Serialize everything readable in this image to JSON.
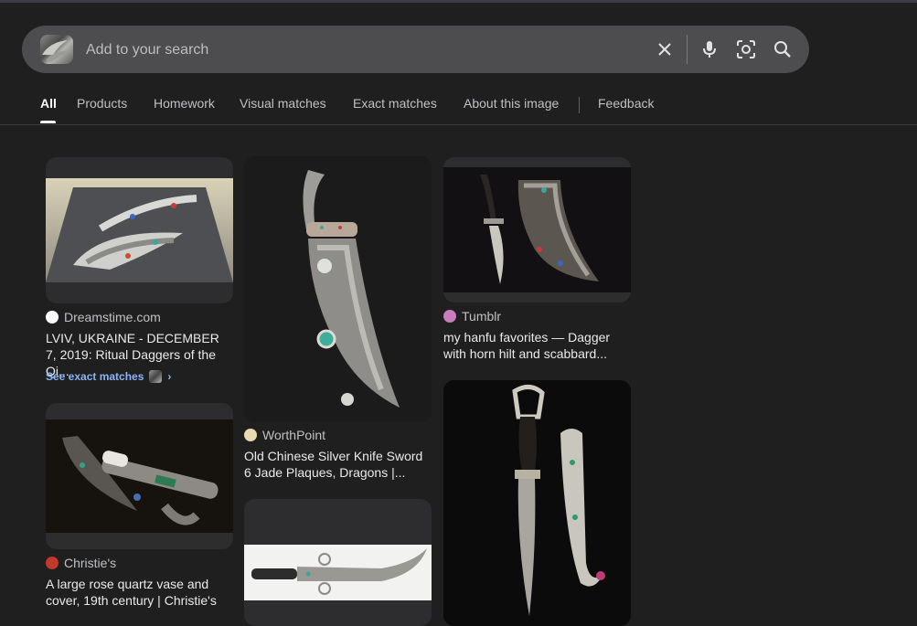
{
  "search": {
    "placeholder": "Add to your search",
    "icons": [
      "clear-icon",
      "mic-icon",
      "lens-icon",
      "search-icon"
    ]
  },
  "tabs": [
    {
      "label": "All",
      "active": true
    },
    {
      "label": "Products"
    },
    {
      "label": "Homework"
    },
    {
      "label": "Visual matches"
    },
    {
      "label": "Exact matches"
    },
    {
      "label": "About this image"
    },
    {
      "label": "Feedback"
    }
  ],
  "results": [
    {
      "source": "Dreamstime.com",
      "title": "LVIV, UKRAINE - DECEMBER 7, 2019: Ritual Daggers of the Qi...",
      "exact": "See exact matches",
      "favicon_color": "#ffffff"
    },
    {
      "source": "Christie's",
      "title": "A large rose quartz vase and cover, 19th century | Christie's",
      "favicon_color": "#c0392b"
    },
    {
      "source": "WorthPoint",
      "title": "Old Chinese Silver Knife Sword 6 Jade Plaques, Dragons |...",
      "favicon_color": "#e8d9b0"
    },
    {
      "source": "Tumblr",
      "title": "my hanfu favorites — Dagger with horn hilt and scabbard...",
      "favicon_color": "#c77dbb"
    }
  ],
  "colors": {
    "background": "#1f1f1f",
    "search_bar": "#4d4d50",
    "link": "#8ab4f8"
  }
}
